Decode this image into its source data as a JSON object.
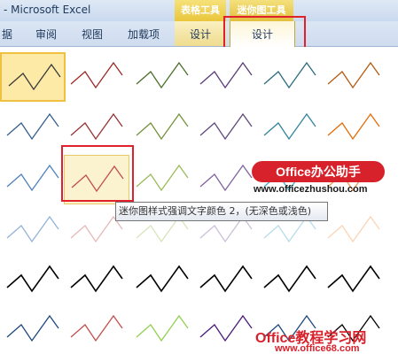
{
  "window": {
    "title": "- Microsoft Excel"
  },
  "contextual_groups": {
    "table_tools": "表格工具",
    "sparkline_tools": "迷你图工具"
  },
  "tabs": [
    {
      "label": "据",
      "active": false
    },
    {
      "label": "审阅",
      "active": false
    },
    {
      "label": "视图",
      "active": false
    },
    {
      "label": "加载项",
      "active": false
    },
    {
      "label": "设计",
      "active": false
    },
    {
      "label": "设计",
      "active": true
    }
  ],
  "gallery": {
    "style_rows": [
      [
        "#3a3a3a",
        "#9b2a2a",
        "#4d6e2a",
        "#5a3c7a",
        "#2c6c7c",
        "#b35a12"
      ],
      [
        "#365f91",
        "#943634",
        "#76923c",
        "#5f497a",
        "#31859c",
        "#e36c09"
      ],
      [
        "#4f81bd",
        "#c0504d",
        "#9bbb59",
        "#8064a2",
        "#4bacc6",
        "#f79646"
      ],
      [
        "#95b3d7",
        "#e6b9b8",
        "#d7e4bd",
        "#ccc0da",
        "#b7dde8",
        "#fbd4b4"
      ],
      [
        "#000000",
        "#000000",
        "#000000",
        "#000000",
        "#000000",
        "#000000"
      ],
      [
        "#1f497d",
        "#c0504d",
        "#92d050",
        "#4a1a7a",
        "#1f497d",
        "#000000"
      ]
    ],
    "row5_varied": [
      "#3f3f3f",
      "#595959",
      "#7f7f7f",
      "#000000",
      "#17375e",
      "#0f243e"
    ],
    "selected_index": 0,
    "hover_index": 13
  },
  "tooltip": {
    "text": "迷你图样式强调文字颜色 2，(无深色或浅色)"
  },
  "watermark": {
    "badge": "Office办公助手",
    "url": "www.officezhushou.com",
    "bottom_title": "Office教程学习网",
    "bottom_url": "www.office68.com"
  }
}
